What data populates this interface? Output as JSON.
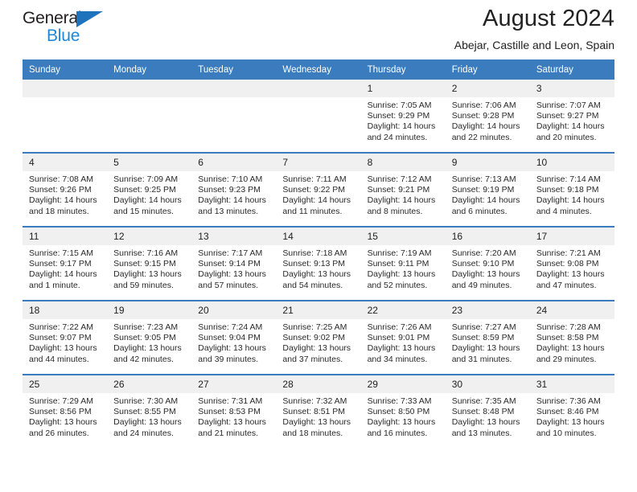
{
  "brand": {
    "name_top": "General",
    "name_bottom": "Blue",
    "triangle_color": "#1f73bd",
    "blue_color": "#1f87d8"
  },
  "header": {
    "title": "August 2024",
    "subtitle": "Abejar, Castille and Leon, Spain",
    "accent_color": "#3a7cbe",
    "daynum_bg": "#f0f0f0"
  },
  "weekday_headers": [
    "Sunday",
    "Monday",
    "Tuesday",
    "Wednesday",
    "Thursday",
    "Friday",
    "Saturday"
  ],
  "labels": {
    "sunrise_prefix": "Sunrise: ",
    "sunset_prefix": "Sunset: ",
    "daylight_prefix": "Daylight: "
  },
  "weeks": [
    [
      {
        "day": "",
        "sunrise": "",
        "sunset": "",
        "daylight_l1": "",
        "daylight_l2": ""
      },
      {
        "day": "",
        "sunrise": "",
        "sunset": "",
        "daylight_l1": "",
        "daylight_l2": ""
      },
      {
        "day": "",
        "sunrise": "",
        "sunset": "",
        "daylight_l1": "",
        "daylight_l2": ""
      },
      {
        "day": "",
        "sunrise": "",
        "sunset": "",
        "daylight_l1": "",
        "daylight_l2": ""
      },
      {
        "day": "1",
        "sunrise": "Sunrise: 7:05 AM",
        "sunset": "Sunset: 9:29 PM",
        "daylight_l1": "Daylight: 14 hours",
        "daylight_l2": "and 24 minutes."
      },
      {
        "day": "2",
        "sunrise": "Sunrise: 7:06 AM",
        "sunset": "Sunset: 9:28 PM",
        "daylight_l1": "Daylight: 14 hours",
        "daylight_l2": "and 22 minutes."
      },
      {
        "day": "3",
        "sunrise": "Sunrise: 7:07 AM",
        "sunset": "Sunset: 9:27 PM",
        "daylight_l1": "Daylight: 14 hours",
        "daylight_l2": "and 20 minutes."
      }
    ],
    [
      {
        "day": "4",
        "sunrise": "Sunrise: 7:08 AM",
        "sunset": "Sunset: 9:26 PM",
        "daylight_l1": "Daylight: 14 hours",
        "daylight_l2": "and 18 minutes."
      },
      {
        "day": "5",
        "sunrise": "Sunrise: 7:09 AM",
        "sunset": "Sunset: 9:25 PM",
        "daylight_l1": "Daylight: 14 hours",
        "daylight_l2": "and 15 minutes."
      },
      {
        "day": "6",
        "sunrise": "Sunrise: 7:10 AM",
        "sunset": "Sunset: 9:23 PM",
        "daylight_l1": "Daylight: 14 hours",
        "daylight_l2": "and 13 minutes."
      },
      {
        "day": "7",
        "sunrise": "Sunrise: 7:11 AM",
        "sunset": "Sunset: 9:22 PM",
        "daylight_l1": "Daylight: 14 hours",
        "daylight_l2": "and 11 minutes."
      },
      {
        "day": "8",
        "sunrise": "Sunrise: 7:12 AM",
        "sunset": "Sunset: 9:21 PM",
        "daylight_l1": "Daylight: 14 hours",
        "daylight_l2": "and 8 minutes."
      },
      {
        "day": "9",
        "sunrise": "Sunrise: 7:13 AM",
        "sunset": "Sunset: 9:19 PM",
        "daylight_l1": "Daylight: 14 hours",
        "daylight_l2": "and 6 minutes."
      },
      {
        "day": "10",
        "sunrise": "Sunrise: 7:14 AM",
        "sunset": "Sunset: 9:18 PM",
        "daylight_l1": "Daylight: 14 hours",
        "daylight_l2": "and 4 minutes."
      }
    ],
    [
      {
        "day": "11",
        "sunrise": "Sunrise: 7:15 AM",
        "sunset": "Sunset: 9:17 PM",
        "daylight_l1": "Daylight: 14 hours",
        "daylight_l2": "and 1 minute."
      },
      {
        "day": "12",
        "sunrise": "Sunrise: 7:16 AM",
        "sunset": "Sunset: 9:15 PM",
        "daylight_l1": "Daylight: 13 hours",
        "daylight_l2": "and 59 minutes."
      },
      {
        "day": "13",
        "sunrise": "Sunrise: 7:17 AM",
        "sunset": "Sunset: 9:14 PM",
        "daylight_l1": "Daylight: 13 hours",
        "daylight_l2": "and 57 minutes."
      },
      {
        "day": "14",
        "sunrise": "Sunrise: 7:18 AM",
        "sunset": "Sunset: 9:13 PM",
        "daylight_l1": "Daylight: 13 hours",
        "daylight_l2": "and 54 minutes."
      },
      {
        "day": "15",
        "sunrise": "Sunrise: 7:19 AM",
        "sunset": "Sunset: 9:11 PM",
        "daylight_l1": "Daylight: 13 hours",
        "daylight_l2": "and 52 minutes."
      },
      {
        "day": "16",
        "sunrise": "Sunrise: 7:20 AM",
        "sunset": "Sunset: 9:10 PM",
        "daylight_l1": "Daylight: 13 hours",
        "daylight_l2": "and 49 minutes."
      },
      {
        "day": "17",
        "sunrise": "Sunrise: 7:21 AM",
        "sunset": "Sunset: 9:08 PM",
        "daylight_l1": "Daylight: 13 hours",
        "daylight_l2": "and 47 minutes."
      }
    ],
    [
      {
        "day": "18",
        "sunrise": "Sunrise: 7:22 AM",
        "sunset": "Sunset: 9:07 PM",
        "daylight_l1": "Daylight: 13 hours",
        "daylight_l2": "and 44 minutes."
      },
      {
        "day": "19",
        "sunrise": "Sunrise: 7:23 AM",
        "sunset": "Sunset: 9:05 PM",
        "daylight_l1": "Daylight: 13 hours",
        "daylight_l2": "and 42 minutes."
      },
      {
        "day": "20",
        "sunrise": "Sunrise: 7:24 AM",
        "sunset": "Sunset: 9:04 PM",
        "daylight_l1": "Daylight: 13 hours",
        "daylight_l2": "and 39 minutes."
      },
      {
        "day": "21",
        "sunrise": "Sunrise: 7:25 AM",
        "sunset": "Sunset: 9:02 PM",
        "daylight_l1": "Daylight: 13 hours",
        "daylight_l2": "and 37 minutes."
      },
      {
        "day": "22",
        "sunrise": "Sunrise: 7:26 AM",
        "sunset": "Sunset: 9:01 PM",
        "daylight_l1": "Daylight: 13 hours",
        "daylight_l2": "and 34 minutes."
      },
      {
        "day": "23",
        "sunrise": "Sunrise: 7:27 AM",
        "sunset": "Sunset: 8:59 PM",
        "daylight_l1": "Daylight: 13 hours",
        "daylight_l2": "and 31 minutes."
      },
      {
        "day": "24",
        "sunrise": "Sunrise: 7:28 AM",
        "sunset": "Sunset: 8:58 PM",
        "daylight_l1": "Daylight: 13 hours",
        "daylight_l2": "and 29 minutes."
      }
    ],
    [
      {
        "day": "25",
        "sunrise": "Sunrise: 7:29 AM",
        "sunset": "Sunset: 8:56 PM",
        "daylight_l1": "Daylight: 13 hours",
        "daylight_l2": "and 26 minutes."
      },
      {
        "day": "26",
        "sunrise": "Sunrise: 7:30 AM",
        "sunset": "Sunset: 8:55 PM",
        "daylight_l1": "Daylight: 13 hours",
        "daylight_l2": "and 24 minutes."
      },
      {
        "day": "27",
        "sunrise": "Sunrise: 7:31 AM",
        "sunset": "Sunset: 8:53 PM",
        "daylight_l1": "Daylight: 13 hours",
        "daylight_l2": "and 21 minutes."
      },
      {
        "day": "28",
        "sunrise": "Sunrise: 7:32 AM",
        "sunset": "Sunset: 8:51 PM",
        "daylight_l1": "Daylight: 13 hours",
        "daylight_l2": "and 18 minutes."
      },
      {
        "day": "29",
        "sunrise": "Sunrise: 7:33 AM",
        "sunset": "Sunset: 8:50 PM",
        "daylight_l1": "Daylight: 13 hours",
        "daylight_l2": "and 16 minutes."
      },
      {
        "day": "30",
        "sunrise": "Sunrise: 7:35 AM",
        "sunset": "Sunset: 8:48 PM",
        "daylight_l1": "Daylight: 13 hours",
        "daylight_l2": "and 13 minutes."
      },
      {
        "day": "31",
        "sunrise": "Sunrise: 7:36 AM",
        "sunset": "Sunset: 8:46 PM",
        "daylight_l1": "Daylight: 13 hours",
        "daylight_l2": "and 10 minutes."
      }
    ]
  ]
}
